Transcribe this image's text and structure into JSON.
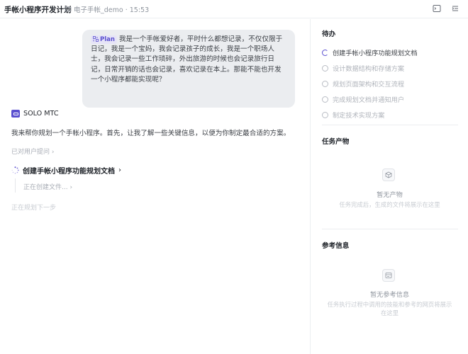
{
  "header": {
    "title": "手帐小程序开发计划",
    "project": "电子手帐_demo · 15:53",
    "icons": [
      "folder-icon",
      "terminal-icon",
      "panel-toggle-icon"
    ]
  },
  "chat": {
    "user_message": {
      "tag": "Plan",
      "text": "我是一个手帐爱好者，平时什么都想记录，不仅仅限于日记，我是一个宝妈，我会记录孩子的成长，我是一个职场人士，我会记录一些工作琐碎，外出旅游的时候也会记录旅行日记，日常开销的话也会记录，喜欢记录在本上。那能不能也开发一个小程序都能实现呢？"
    },
    "agent": {
      "name": "SOLO MTC",
      "message": "我来帮你规划一个手帐小程序。首先，让我了解一些关键信息，以便为你制定最合适的方案。",
      "asked_label": "已对用户提问",
      "step_title": "创建手帐小程序功能规划文档",
      "step_status": "正在创建文件...",
      "planning": "正在规划下一步"
    }
  },
  "sidebar": {
    "todo_title": "待办",
    "todos": [
      {
        "label": "创建手帐小程序功能规划文档",
        "state": "in-progress"
      },
      {
        "label": "设计数据结构和存储方案",
        "state": "pending"
      },
      {
        "label": "规划页面架构和交互流程",
        "state": "pending"
      },
      {
        "label": "完成规划文档并通知用户",
        "state": "pending"
      },
      {
        "label": "制定技术实现方案",
        "state": "pending"
      }
    ],
    "artifacts": {
      "title": "任务产物",
      "empty_title": "暂无产物",
      "empty_desc": "任务完成后，生成的文件将展示在这里"
    },
    "references": {
      "title": "参考信息",
      "empty_title": "暂无参考信息",
      "empty_desc": "任务执行过程中调用的技能和参考的网页将展示在这里"
    }
  },
  "colors": {
    "accent": "#5a4fcf",
    "bubble_bg": "#ebedf0",
    "muted_text": "#a8adb5"
  }
}
